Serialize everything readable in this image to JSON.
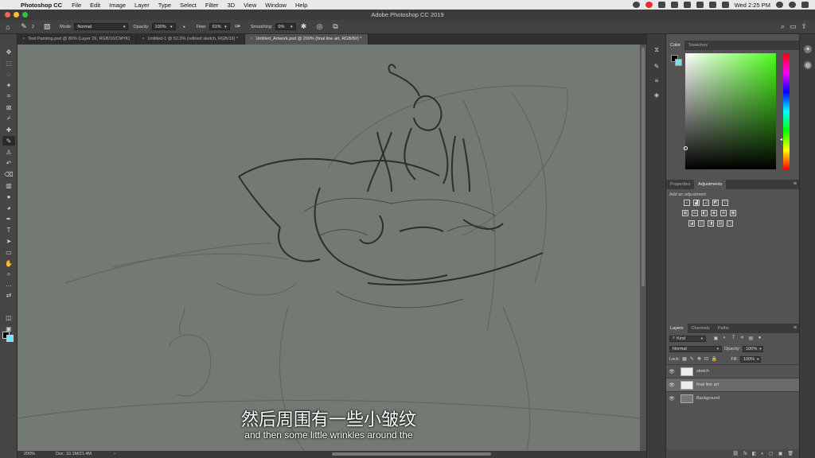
{
  "menubar": {
    "apple": "",
    "app": "Photoshop CC",
    "items": [
      "File",
      "Edit",
      "Image",
      "Layer",
      "Type",
      "Select",
      "Filter",
      "3D",
      "View",
      "Window",
      "Help"
    ],
    "clock": "Wed 2:25 PM"
  },
  "window": {
    "title": "Adobe Photoshop CC 2019"
  },
  "options": {
    "brush_size": "2",
    "mode_label": "Mode:",
    "mode_value": "Normal",
    "opacity_label": "Opacity:",
    "opacity_value": "100%",
    "flow_label": "Flow:",
    "flow_value": "61%",
    "smoothing_label": "Smoothing:",
    "smoothing_value": "0%"
  },
  "tabs": [
    {
      "label": "Test Painting.psd @ 80% (Layer 26, RGB/16/CMYK)",
      "close": "×"
    },
    {
      "label": "Untitled-1 @ 52.3% (refined sketch, RGB/16) *",
      "close": "×"
    },
    {
      "label": "Untitled_Artwork.psd @ 200% (final line art, RGB/8#) *",
      "close": "×"
    }
  ],
  "subtitles": {
    "chinese": "然后周围有一些小皱纹",
    "english": "and then some little wrinkles around the"
  },
  "status": {
    "zoom": "200%",
    "doc": "Doc: 10.1M/21.4M",
    "arrow": "›"
  },
  "color_panel": {
    "tabs": [
      "Color",
      "Swatches"
    ],
    "fg": "#000000",
    "bg": "#6ee3ff",
    "hue": "#4cff1a"
  },
  "adjust_panel": {
    "tabs": [
      "Properties",
      "Adjustments"
    ],
    "title": "Add an adjustment"
  },
  "layers_panel": {
    "tabs": [
      "Layers",
      "Channels",
      "Paths"
    ],
    "kind": "Kind",
    "blend": "Normal",
    "opacity_label": "Opacity:",
    "opacity_value": "100%",
    "lock_label": "Lock:",
    "fill_label": "Fill:",
    "fill_value": "100%",
    "layers": [
      {
        "name": "sketch",
        "visible": true
      },
      {
        "name": "final line art",
        "visible": true
      },
      {
        "name": "Background",
        "visible": true
      }
    ],
    "footer": [
      "⛓",
      "fx",
      "◧",
      "◐",
      "▢",
      "▣",
      "🗑"
    ]
  },
  "colors": {
    "accent": "#2a2a2a",
    "canvas": "#737a73",
    "panel": "#535353"
  }
}
